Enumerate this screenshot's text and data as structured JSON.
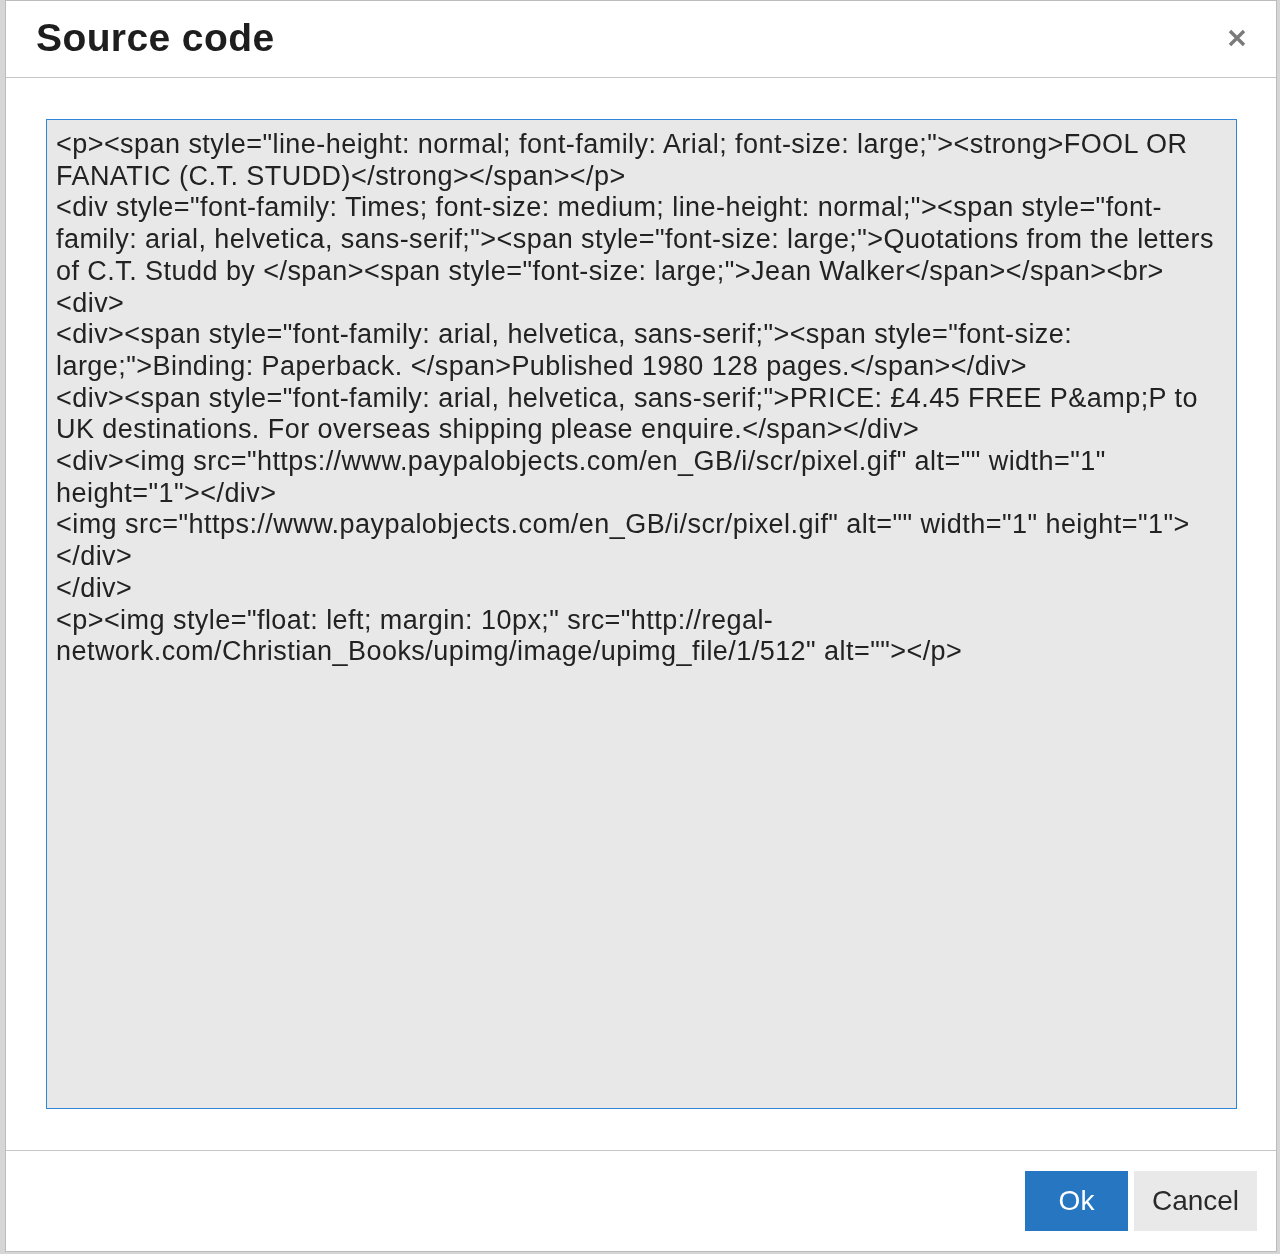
{
  "dialog": {
    "title": "Source code"
  },
  "editor": {
    "focused": true,
    "value": "<p><span style=\"line-height: normal; font-family: Arial; font-size: large;\"><strong>FOOL OR FANATIC (C.T. STUDD)</strong></span></p>\n<div style=\"font-family: Times; font-size: medium; line-height: normal;\"><span style=\"font-family: arial, helvetica, sans-serif;\"><span style=\"font-size: large;\">Quotations from the letters of C.T. Studd by </span><span style=\"font-size: large;\">Jean Walker</span></span><br>\n<div>\n<div><span style=\"font-family: arial, helvetica, sans-serif;\"><span style=\"font-size: large;\">Binding: Paperback. </span>Published 1980 128 pages.</span></div>\n<div><span style=\"font-family: arial, helvetica, sans-serif;\">PRICE: £4.45 FREE P&amp;P to UK destinations. For overseas shipping please enquire.</span></div>\n<div><img src=\"https://www.paypalobjects.com/en_GB/i/scr/pixel.gif\" alt=\"\" width=\"1\" height=\"1\"></div>\n<img src=\"https://www.paypalobjects.com/en_GB/i/scr/pixel.gif\" alt=\"\" width=\"1\" height=\"1\"></div>\n</div>\n<p><img style=\"float: left; margin: 10px;\" src=\"http://regal-network.com/Christian_Books/upimg/image/upimg_file/1/512\" alt=\"\"></p>"
  },
  "buttons": [
    {
      "label": "Ok",
      "kind": "primary"
    },
    {
      "label": "Cancel",
      "kind": "secondary"
    }
  ]
}
